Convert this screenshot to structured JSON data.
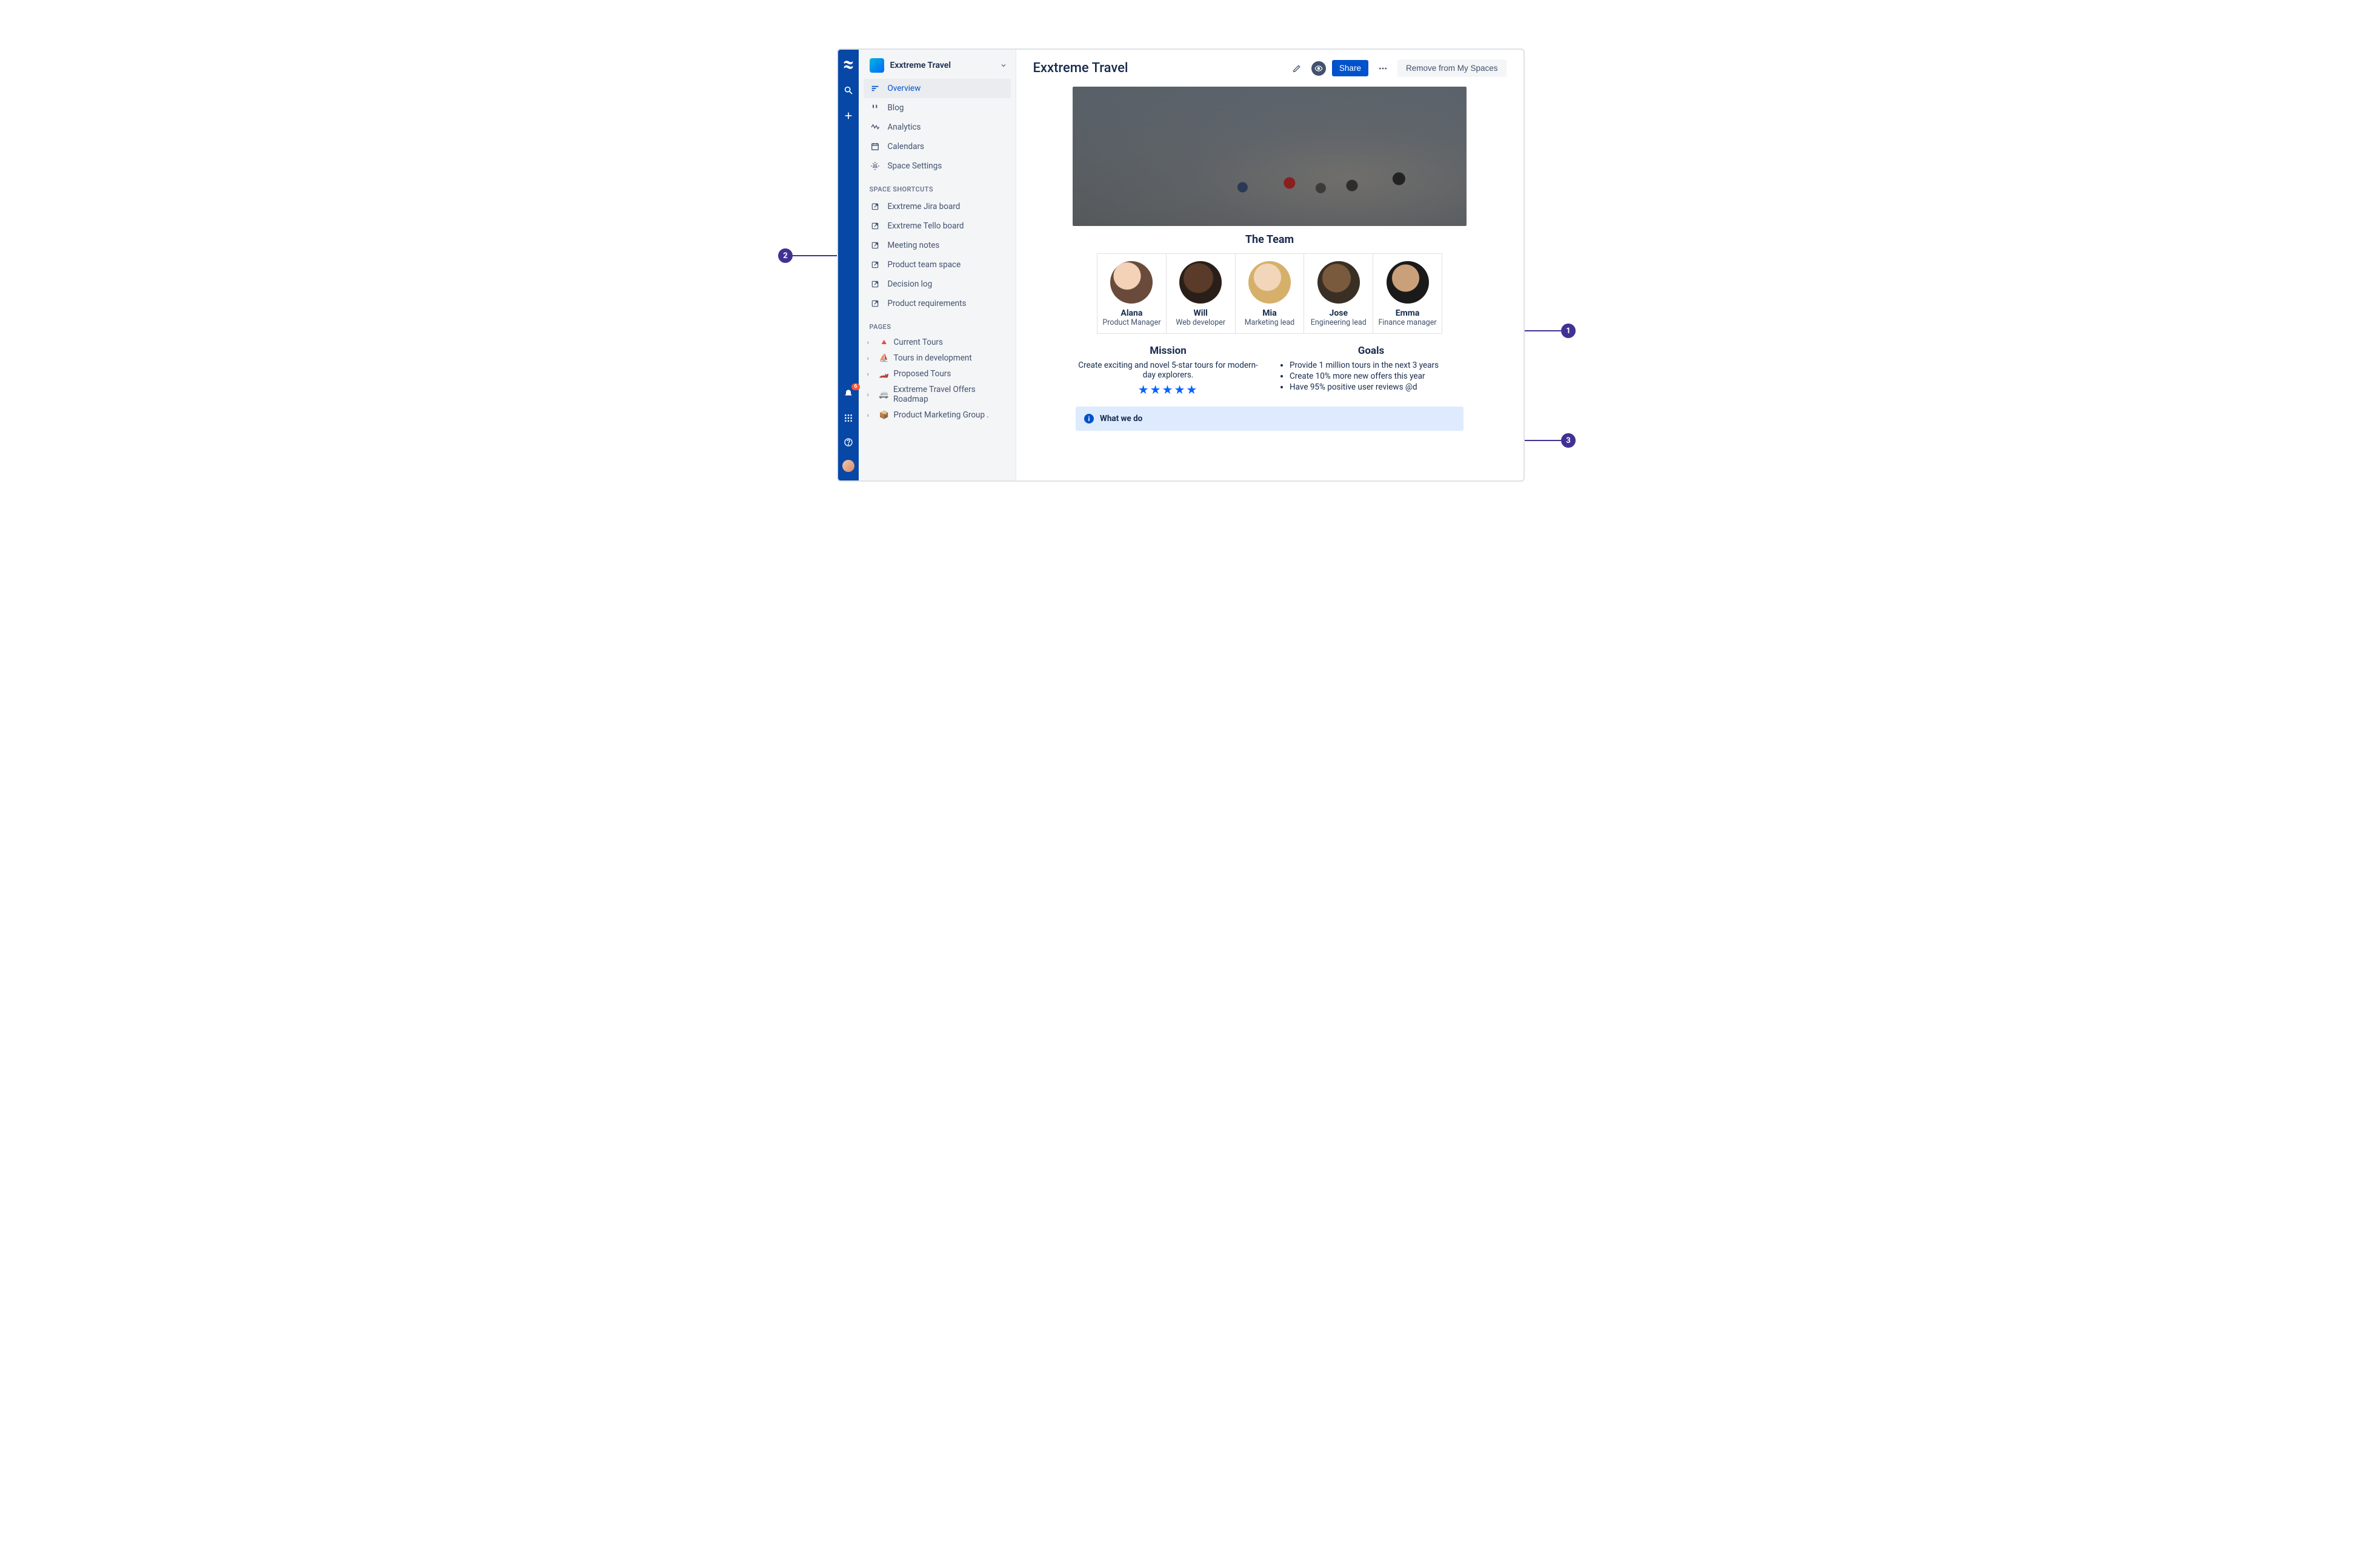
{
  "global_rail": {
    "notification_count": "6"
  },
  "sidebar": {
    "space_name": "Exxtreme Travel",
    "nav": [
      {
        "label": "Overview",
        "icon": "overview"
      },
      {
        "label": "Blog",
        "icon": "blog"
      },
      {
        "label": "Analytics",
        "icon": "analytics"
      },
      {
        "label": "Calendars",
        "icon": "calendar"
      },
      {
        "label": "Space Settings",
        "icon": "settings"
      }
    ],
    "shortcuts_label": "SPACE SHORTCUTS",
    "shortcuts": [
      {
        "label": "Exxtreme Jira board"
      },
      {
        "label": "Exxtreme Tello board"
      },
      {
        "label": "Meeting notes"
      },
      {
        "label": "Product team space"
      },
      {
        "label": "Decision log"
      },
      {
        "label": "Product requirements"
      }
    ],
    "pages_label": "PAGES",
    "pages": [
      {
        "emoji": "🔺",
        "label": "Current Tours"
      },
      {
        "emoji": "⛵",
        "label": "Tours in development"
      },
      {
        "emoji": "🏎️",
        "label": "Proposed Tours"
      },
      {
        "emoji": "🚐",
        "label": "Exxtreme Travel Offers Roadmap"
      },
      {
        "emoji": "📦",
        "label": "Product Marketing Group ."
      }
    ]
  },
  "header": {
    "title": "Exxtreme Travel",
    "share": "Share",
    "remove": "Remove from My Spaces"
  },
  "team": {
    "heading": "The Team",
    "members": [
      {
        "name": "Alana",
        "role": "Product Manager"
      },
      {
        "name": "Will",
        "role": "Web developer"
      },
      {
        "name": "Mia",
        "role": "Marketing lead"
      },
      {
        "name": "Jose",
        "role": "Engineering lead"
      },
      {
        "name": "Emma",
        "role": "Finance manager"
      }
    ]
  },
  "mission": {
    "heading": "Mission",
    "text": "Create exciting and novel 5-star tours for modern-day explorers."
  },
  "goals": {
    "heading": "Goals",
    "items": [
      "Provide 1 million tours in the next 3 years",
      "Create 10% more new offers this year",
      "Have 95% positive user reviews @d"
    ]
  },
  "info": {
    "title": "What we do"
  },
  "callouts": {
    "c1": "1",
    "c2": "2",
    "c3": "3"
  }
}
